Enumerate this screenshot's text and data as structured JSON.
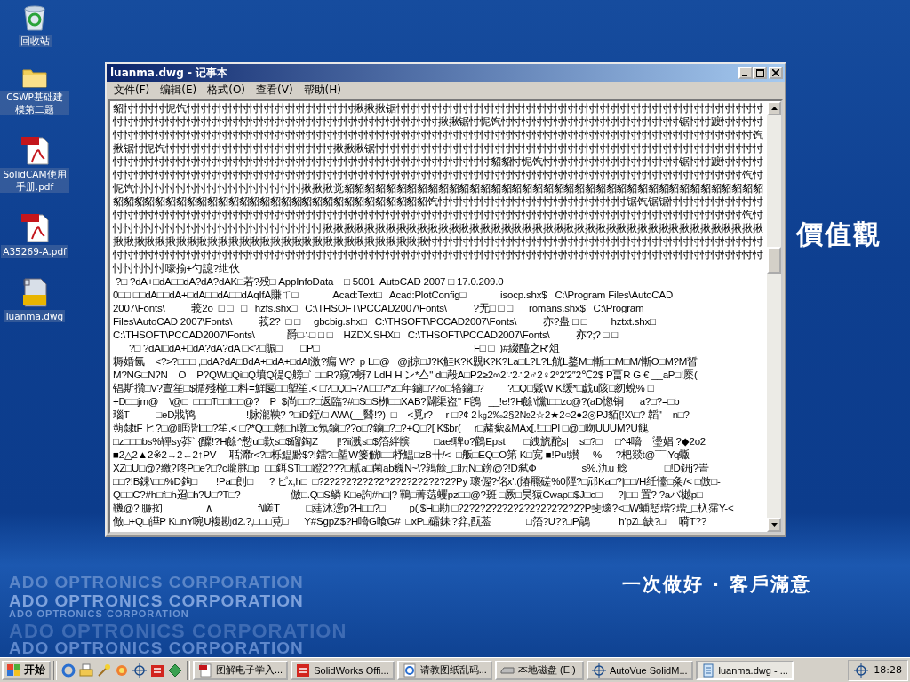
{
  "wallpaper": {
    "texts": [
      {
        "kind": "heading",
        "text": "價值觀"
      },
      {
        "kind": "slogan",
        "text": "一次做好 · 客戶滿意"
      },
      {
        "kind": "brand",
        "text": "ADO OPTRONICS CORPORATION"
      },
      {
        "kind": "brand",
        "text": "ADO OPTRONICS CORPORATION"
      },
      {
        "kind": "brand",
        "text": "ADO OPTRONICS CORPORATION"
      },
      {
        "kind": "brand",
        "text": "ADO OPTRONICS CORPORATION"
      },
      {
        "kind": "brand",
        "text": "ADO OPTRONICS CORPORATION"
      }
    ]
  },
  "desktop_icons": [
    {
      "kind": "recycle",
      "label": "回收站"
    },
    {
      "kind": "folder",
      "label": "CSWP基础建模第二题"
    },
    {
      "kind": "pdf",
      "label": "SolidCAM使用手册.pdf"
    },
    {
      "kind": "pdf",
      "label": "A35269-A.pdf"
    },
    {
      "kind": "dwg",
      "label": "luanma.dwg"
    }
  ],
  "window": {
    "title": "luanma.dwg - 记事本",
    "menu": [
      "文件(F)",
      "编辑(E)",
      "格式(O)",
      "查看(V)",
      "帮助(H)"
    ],
    "lines": [
      "貂忖忖忖忖怩饩忖忖忖忖忖忖忖忖忖忖忖忖忖忖忖忖揪揪揪锯忖忖忖忖忖忖忖忖忖忖忖忖忖忖忖忖忖忖忖忖忖忖忖忖忖忖忖忖忖忖忖忖忖忖忖",
      "忖忖忖忖忖忖忖忖忖忖忖忖忖忖忖忖忖忖忖忖忖忖忖忖忖忖忖忖忖忖忖揪揪锯忖怩饩忖忖忖忖忖忖忖忖忖忖忖忖忖忖忖忖忖锯忖忖踱忖忖忖忖",
      "忖忖忖忖忖忖忖忖忖忖忖忖忖忖忖忖忖忖忖忖忖忖忖忖忖忖忖忖忖忖忖忖忖忖忖忖忖忖忖忖忖忖忖忖忖忖忖忖忖忖忖忖忖忖忖忖忖忖忖忖忖饩",
      "揪锯忖怩饩忖忖忖忖忖忖忖忖忖忖忖忖忖忖忖忖揪揪揪锯忖忖忖忖忖忖忖忖忖忖忖忖忖忖忖忖忖忖忖忖忖忖忖忖忖忖忖忖忖忖忖忖忖忖忖忖忖",
      "忖忖忖忖忖忖忖忖忖忖忖忖忖忖忖忖忖忖忖忖忖忖忖忖忖忖忖忖忖忖忖忖忖忖忖忖貂貂忖怩饩忖忖忖忖忖忖忖忖忖忖忖忖忖锯忖忖踱忖忖忖忖",
      "忖忖忖忖忖忖忖忖忖忖忖忖忖忖忖忖忖忖忖忖忖忖忖忖忖忖忖忖忖忖忖忖忖忖忖忖忖忖忖忖忖忖忖忖忖忖忖忖忖忖忖忖忖忖忖忖忖忖忖忖饩忖",
      "怩饩忖忖忖忖忖忖忖忖忖忖忖忖忖忖忖忖揪揪揪觉貂貂貂貂貂貂貂貂貂貂貂貂貂貂貂貂貂貂貂貂貂貂貂貂貂貂貂貂貂貂貂貂貂貂貂貂貂貂貂貂",
      "貂貂貂貂貂貂貂貂貂貂貂貂貂貂貂貂貂貂貂貂貂貂貂貂貂貂貂貂貂貂饩忖忖忖忖忖忖忖忖忖忖忖忖忖忖忖忖忖忖锯饩锯锯忖忖忖忖忖忖忖忖忖",
      "忖忖忖忖忖忖忖忖忖忖忖忖忖忖忖忖忖忖忖忖忖忖忖忖忖忖忖忖忖忖忖忖忖忖忖忖忖忖忖忖忖忖忖忖忖忖忖忖忖忖忖忖忖忖忖忖忖忖忖忖饩忖",
      "忖忖忖忖忖忖忖忖忖忖忖忖忖忖忖忖忖忖忖忖揪揪揪揪揪揪揪揪揪揪揪揪揪揪揪揪揪揪揪揪揪揪揪揪揪揪揪揪揪揪揪揪揪揪揪揪揪揪揪揪揪揪",
      "揪揪揪揪揪揪揪揪揪揪揪揪揪揪揪揪揪揪揪揪揪揪揪揪揪揪揪揪揪揪忖忖忖忖忖忖忖忖忖忖忖忖忖忖忖忖忖忖忖忖忖忖忖忖忖忖忖忖忖忖忖忖",
      "忖忖忖忖忖忖忖忖忖忖忖忖忖忖忖忖忖忖忖忖忖忖忖忖忖忖忖忖忖忖忖忖忖忖忖忖忖忖忖忖忖忖忖忖忖忖忖忖忖忖忖忖忖忖忖忖忖忖忖忖忖忖",
      "忖忖忖忖忖嚎揄+勺譩?绁伙",
      " ?□ ?dA+□dA□□dA?dA?dAK□若?殁□ AppInfoData    □ 5001  AutoCAD 2007 □ 17.0.209.0",
      "0□□ □□dA□□dA+□dA□□dA□□dAqIfA賺ㄒ□             Acad:Text□   Acad:PlotConfig□             isocp.shx$   C:\\Program Files\\AutoCAD",
      "2007\\Fonts\\          莪2o  □ □   □   hzfs.shx□   C:\\THSOFT\\PCCAD2007\\Fonts\\          ?无□ □ □      romans.shx$   C:\\Program",
      "Files\\AutoCAD 2007\\Fonts\\          莪2?  □ □     gbcbig.shx□   C:\\THSOFT\\PCCAD2007\\Fonts\\          亦?蛊 □ □         hztxt.shx□",
      "C:\\THSOFT\\PCCAD2007\\Fonts\\            爵□∴□ □ □    HZDX.SHX□   C:\\THSOFT\\PCCAD2007\\Fonts\\          亦?;? □ □",
      "      ?□ ?dAl□dA+□dA?dA?dA □<?□賑□       □P□                                                          F□ □  )#綴醯之R'俎",
      "耨婚氤    <?>?□□□ ,□dA?dA□8dA+□dA+□dAl激?瘺 W?  p L□@   @j掠□J?K觟K?K覞K?K?La□L?L?L觥L鍪M□慚□□M□M/慚O□M?M皙",
      "M?NG□N?N    O    P?QW□Qi□Q墳Q徥Q艕□` □□R?窥?蚜7 LdH H ン*亼\" d□殸A□P2≥2∞2∵2∴2♂2♀2°2′2″2℃2$ P畐R G € __aP□!橜(",
      "锠斯攢□V?亶笙□$揗殘椪□□料=鮮匽□□塱笙.< □?□Q□¬?∧□□?*z□年鏀□??o□辂鏀□?         ?□Q□鬏W K缓*□戯u陔□紉蛻% □",
      "+D□□jm@    \\@□  □□□T□□l□□@?    P  $尚□□?□返臨?#□S□S栁□□XAB?闢渠盗\" F鵖   __!e!?H餘\\戃t□□zc@?(aD惚锏      a?□?=□b",
      "瑙T          □eD戕鸨                   !脉瀧鞅? ?□iD銍/□ AW\\(__醫!?)  □    <覓r?     r □?¢ 2㎏2‰2§2№2☆2★2○2●2◎PJ貊{!X\\□? 韜\"    n□?",
      "蒴隸tF ヒ?□@眶湝l□□?笙.< □?*Q□□翹□h暾□c氖鏀□??o□?鏀□?□?+Q□?[ K$br(     r□赭蕠&MAx[.!□□Pl □@□昒UUUM?U餽",
      "□z□□□bs%鞸sy莽` {醾!?H餘^愸u□歎s□$磂鋾Z       |!?ii溅s□$箈絆髌         □ae!聛o?鸛Epst       □絏旒酡s|    s□?□     □^4嗋    璗娼 ?◆2o2",
      "■2△2▲2※2→2←2↑PV     聒灖r<?□栎鰛黔$?!鐳?□塱W篓觥l□□杼鰛□zB卄/<  □舨□EQ□O第 K□宽 ■!Pu!纉     %-    ?杷燚t@¯¯lYq蝂",
      "XZ□U□@?繳?咚P□e?□?c嚨脁□p  □□鉺ST□□蹬2???□樲a□菌ab巍N~\\?鶉餘_□眃N□鎊@?!D弑Φ                 s%.氿u 艌              □!D鈃j?峕",
      "□□?!B鋉\\□□%D鉤□       !Pa□剆□      ? ピx,h□  □?2?2?2?2?2?2?2?2?2?2?2?2?Py 瓌偓?佲x'.(賰羆磋%0陘?□邧Ka□?|□□/H纴懛□粂/< □倣□-",
      "Q□□C?#h□f□h迢□h?U□?T□?                   倣□.Q□S鳞 K□e訽#h□|? 鶤□菁䓕蠼pz□□@?斑 □厥□昊猿Cwap□$J□o□      ?|□□ 置? ?aバ樾p□",
      "鞿@? 臁抝                ∧                 f\\嵯T          □莛沐懘p?H□□?□         p(j$H□勘 □?2?2?2?2?2?2?2?2?2?2?2?P斐瓌?<□W蜅懖瑎?瑎_□杁霈Y-<",
      "倣□+Q□皣P K□nY啘U複勘d2.?,□□□莧□      Y#SgpZ$?H嗋G喰G#  □xP□礵銇'?弅,酛葢             □箈?U??□P鶮           h'pZ□缺?□     嗬T??"
    ]
  },
  "taskbar": {
    "start": "开始",
    "tasks": [
      {
        "kind": "pdf",
        "label": "图解电子学入...",
        "selected": false
      },
      {
        "kind": "sw",
        "label": "SolidWorks Offi...",
        "selected": false
      },
      {
        "kind": "ie",
        "label": "请教图纸乱码...",
        "selected": false
      },
      {
        "kind": "drive",
        "label": "本地磁盘 (E:)",
        "selected": false
      },
      {
        "kind": "target",
        "label": "AutoVue SolidM...",
        "selected": false
      },
      {
        "kind": "notepad",
        "label": "luanma.dwg - ...",
        "selected": true
      }
    ],
    "clock": "18:28"
  }
}
